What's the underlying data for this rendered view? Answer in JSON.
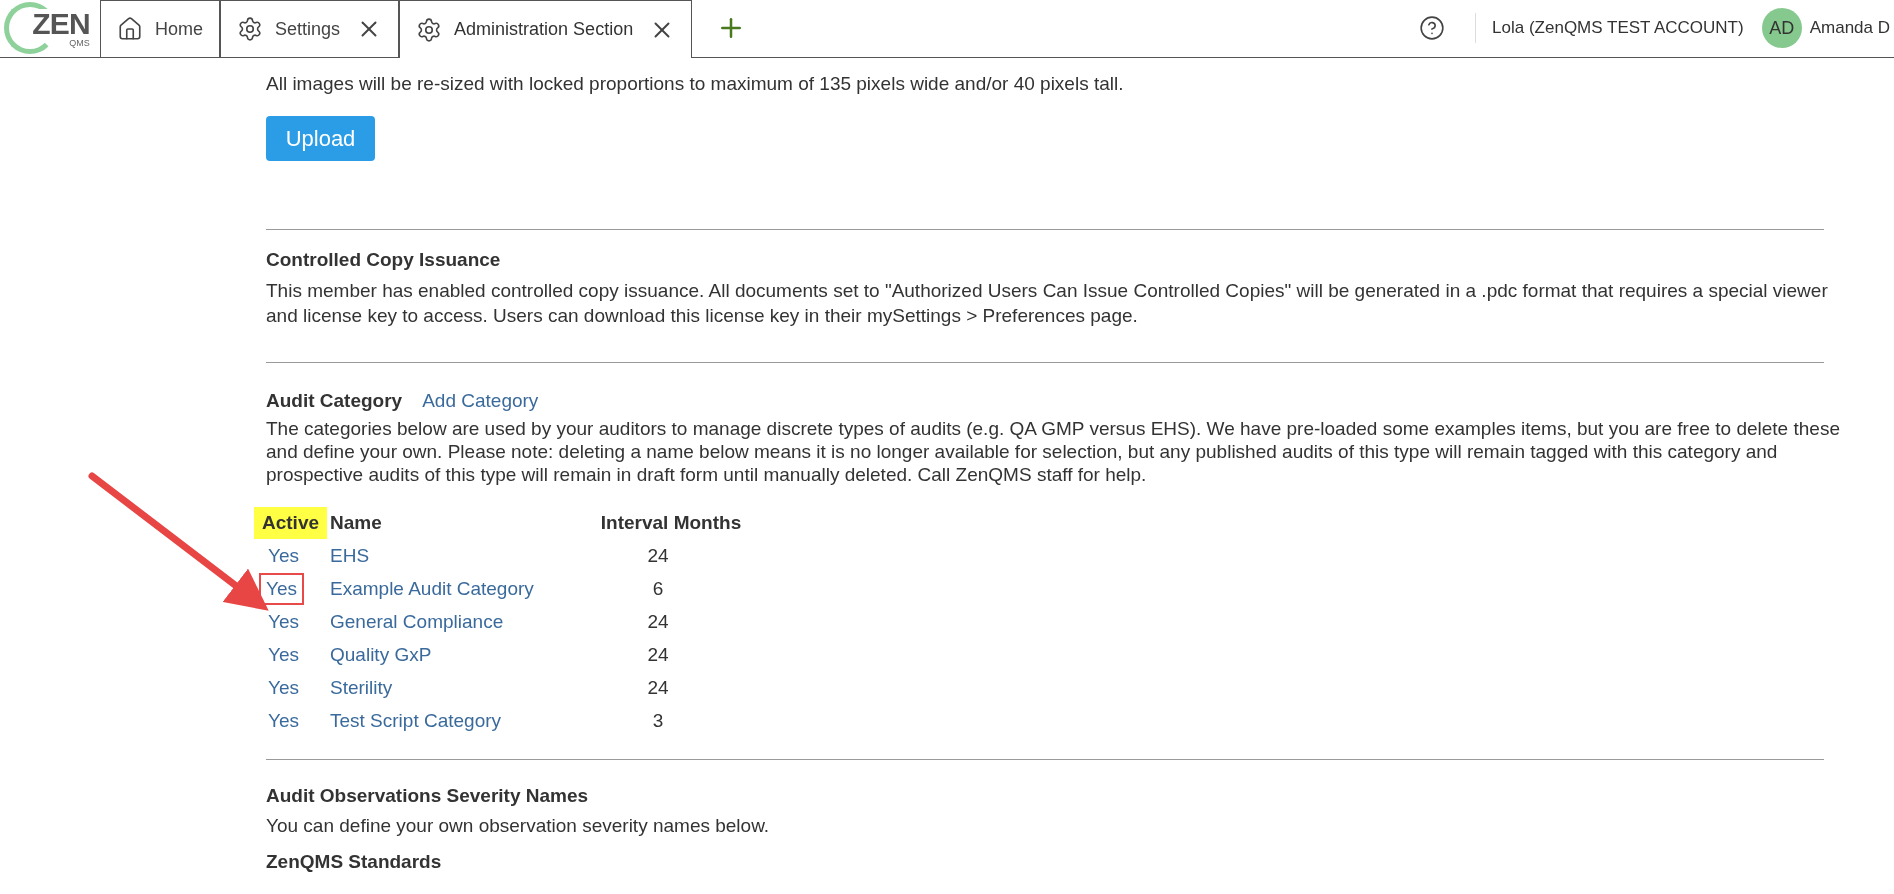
{
  "logo": {
    "main": "ZEN",
    "sub": "QMS"
  },
  "tabs": [
    {
      "label": "Home",
      "closable": false,
      "selected": false
    },
    {
      "label": "Settings",
      "closable": true,
      "selected": false
    },
    {
      "label": "Administration Section",
      "closable": true,
      "selected": true
    }
  ],
  "header": {
    "account": "Lola (ZenQMS TEST ACCOUNT)",
    "avatar_initials": "AD",
    "user": "Amanda D"
  },
  "logo_section": {
    "note": "All images will be re-sized with locked proportions to maximum of 135 pixels wide and/or 40 pixels tall.",
    "button": "Upload"
  },
  "controlled_copy": {
    "title": "Controlled Copy Issuance",
    "text": "This member has enabled controlled copy issuance. All documents set to \"Authorized Users Can Issue Controlled Copies\" will be generated in a .pdc format that requires a special viewer and license key to access. Users can download this license key in their mySettings > Preferences page."
  },
  "audit_category": {
    "title": "Audit Category",
    "link": "Add Category",
    "text": "The categories below are used by your auditors to manage discrete types of audits (e.g. QA GMP versus EHS). We have pre-loaded some examples items, but you are free to delete these and define your own. Please note: deleting a name below means it is no longer available for selection, but any published audits of this type will remain tagged with this category and prospective audits of this type will remain in draft form until manually deleted. Call ZenQMS staff for help.",
    "columns": [
      {
        "label": "Active",
        "highlighted": true
      },
      {
        "label": "Name",
        "highlighted": false
      },
      {
        "label": "Interval Months",
        "highlighted": false
      }
    ],
    "rows": [
      {
        "active": "Yes",
        "name": "EHS",
        "interval": "24",
        "outlined": false
      },
      {
        "active": "Yes",
        "name": "Example Audit Category",
        "interval": "6",
        "outlined": true
      },
      {
        "active": "Yes",
        "name": "General Compliance",
        "interval": "24",
        "outlined": false
      },
      {
        "active": "Yes",
        "name": "Quality GxP",
        "interval": "24",
        "outlined": false
      },
      {
        "active": "Yes",
        "name": "Sterility",
        "interval": "24",
        "outlined": false
      },
      {
        "active": "Yes",
        "name": "Test Script Category",
        "interval": "3",
        "outlined": false
      }
    ]
  },
  "severity": {
    "title": "Audit Observations Severity Names",
    "text": "You can define your own observation severity names below."
  },
  "next_section": {
    "title": "ZenQMS Standards"
  }
}
